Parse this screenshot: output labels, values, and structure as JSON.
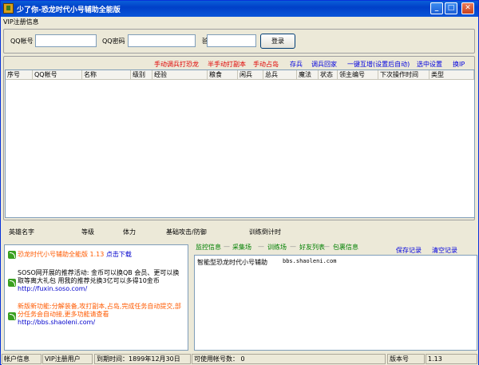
{
  "window": {
    "title": "少了你-恐龙时代小号辅助全能版"
  },
  "menu": {
    "vip": "VIP注册信息"
  },
  "login": {
    "qq_label": "QQ帐号",
    "pwd_label": "QQ密码",
    "code_label": "验证码",
    "login_button": "登录",
    "qq_value": "",
    "pwd_value": "",
    "code_value": ""
  },
  "toolbar": {
    "manual_escort": "手动调兵打恐龙",
    "semi_manual_dungeon": "半手动打副本",
    "manual_island": "手动占岛",
    "store_troops": "存兵",
    "recall_troops": "调兵回家",
    "one_key_tiers": "一键互增(设置后自动)",
    "select_settings": "选中设置",
    "change_ip": "换IP"
  },
  "table": {
    "columns": [
      "序号",
      "QQ帐号",
      "名称",
      "级别",
      "经验",
      "粮食",
      "闲兵",
      "总兵",
      "魔法",
      "状态",
      "领主编号",
      "下次操作时间",
      "类型"
    ],
    "rows": []
  },
  "hero": {
    "name": "英雄名字",
    "level": "等级",
    "stamina": "体力",
    "attack_defense": "基础攻击/防御",
    "train_countdown": "训练倒计时"
  },
  "news": [
    {
      "text": "恐龙时代小号辅助全能版 1.13",
      "link": "点击下载"
    },
    {
      "text": "SOSO网开展的推荐活动: 金币可以换QB 会员、更可以换取等离大礼包 用我的推荐兑换3亿可以多得10金币",
      "link": "http://fuxin.soso.com/"
    },
    {
      "text": "新版新功能:分解装备,攻打副本,占岛,完成任务自动提交,部分任务会自动接,更多功能请查看",
      "link": "http://bbs.shaoleni.com/"
    }
  ],
  "tabs": {
    "items": [
      "监控信息",
      "采集场",
      "训练场",
      "好友列表",
      "包裹信息"
    ],
    "save_log": "保存记录",
    "clear_log": "清空记录"
  },
  "log": {
    "line1_title": "智能型恐龙时代小号辅助",
    "line1_url": "bbs.shaoleni.com"
  },
  "status": {
    "account_info": "帐户信息",
    "vip_user": "VIP注册用户",
    "expire": "到期时间：1899年12月30日",
    "usable": "可使用帐号数： 0",
    "version_label": "版本号",
    "version": "1.13"
  }
}
